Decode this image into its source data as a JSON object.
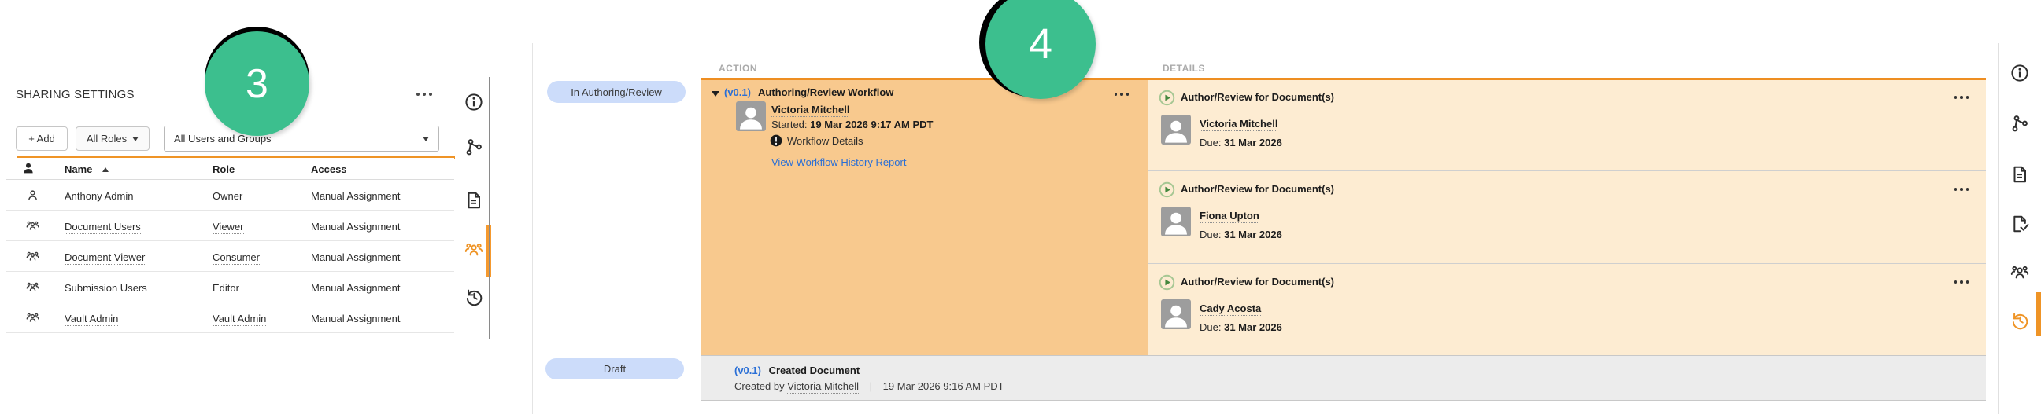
{
  "markers": {
    "three": "3",
    "four": "4"
  },
  "colors": {
    "accent_orange": "#EF9426",
    "action_bg": "#F8C98E",
    "details_bg": "#FDECD2",
    "state_pill_bg": "#CCDCFA",
    "link_blue": "#2A6FD6",
    "marker_green": "#3CBF8E",
    "draft_row_bg": "#ECECEC"
  },
  "sharing": {
    "title": "SHARING SETTINGS",
    "toolbar": {
      "add": "+ Add",
      "roles": "All Roles",
      "scope": "All Users and Groups"
    },
    "table": {
      "name_header": "Name",
      "role_header": "Role",
      "access_header": "Access",
      "rows": [
        {
          "name": "Anthony Admin",
          "role": "Owner",
          "access": "Manual Assignment",
          "type": "user"
        },
        {
          "name": "Document Users",
          "role": "Viewer",
          "access": "Manual Assignment",
          "type": "group"
        },
        {
          "name": "Document Viewer",
          "role": "Consumer",
          "access": "Manual Assignment",
          "type": "group"
        },
        {
          "name": "Submission Users",
          "role": "Editor",
          "access": "Manual Assignment",
          "type": "group"
        },
        {
          "name": "Vault Admin",
          "role": "Vault Admin",
          "access": "Manual Assignment",
          "type": "group"
        }
      ]
    }
  },
  "left_rail_icons": [
    "info",
    "workflow",
    "document",
    "users",
    "history"
  ],
  "right_rail_icons": [
    "info",
    "workflow",
    "document",
    "checklist",
    "users",
    "history"
  ],
  "timeline": {
    "action_header": "ACTION",
    "details_header": "DETAILS",
    "state_current": "In Authoring/Review",
    "state_draft": "Draft",
    "workflow": {
      "version": "(v0.1)",
      "title": "Authoring/Review Workflow",
      "owner": "Victoria Mitchell",
      "started_label": "Started:",
      "started": "19 Mar 2026 9:17 AM PDT",
      "details_link": "Workflow Details",
      "history_link": "View Workflow History Report"
    },
    "tasks": [
      {
        "title": "Author/Review for Document(s)",
        "assignee": "Victoria Mitchell",
        "due_label": "Due:",
        "due": "31 Mar 2026"
      },
      {
        "title": "Author/Review for Document(s)",
        "assignee": "Fiona Upton",
        "due_label": "Due:",
        "due": "31 Mar 2026"
      },
      {
        "title": "Author/Review for Document(s)",
        "assignee": "Cady Acosta",
        "due_label": "Due:",
        "due": "31 Mar 2026"
      }
    ],
    "created": {
      "version": "(v0.1)",
      "title": "Created Document",
      "by_label": "Created by",
      "by": "Victoria Mitchell",
      "separator": "|",
      "timestamp": "19 Mar 2026 9:16 AM PDT"
    }
  }
}
